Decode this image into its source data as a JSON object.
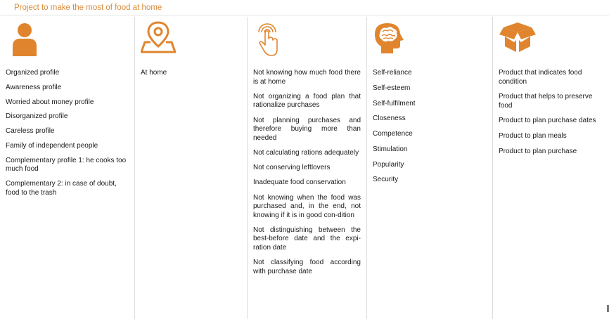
{
  "title": "Project to make the most of food at home",
  "accent_color": "#e0852e",
  "columns": [
    {
      "icon": "person-icon",
      "items": [
        "Organized profile",
        "Awareness profile",
        "Worried about money profile",
        "Disorganized profile",
        "Careless profile",
        "Family of independent people",
        "Complementary profile 1: he cooks too much food",
        "Complementary 2: in case of doubt, food to the trash"
      ]
    },
    {
      "icon": "location-map-icon",
      "items": [
        "At home"
      ]
    },
    {
      "icon": "touch-finger-icon",
      "items": [
        "Not knowing how much food there is at home",
        "Not organizing a food plan that rationalize purchases",
        "Not planning purchases and therefore buying more than needed",
        "Not calculating rations adequately",
        "Not conserving leftlovers",
        "Inadequate food conservation",
        "Not knowing when the food was purchased and, in the end, not knowing if it is in good con-dition",
        "Not distinguishing between the best-before date and the expi-ration date",
        "Not classifying food according with purchase date"
      ]
    },
    {
      "icon": "head-brain-icon",
      "items": [
        "Self-reliance",
        "Self-esteem",
        "Self-fulfilment",
        "Closeness",
        "Competence",
        "Stimulation",
        "Popularity",
        "Security"
      ]
    },
    {
      "icon": "open-box-icon",
      "items": [
        "Product that indicates food condition",
        "Product that helps to preserve food",
        "Product to plan purchase dates",
        "Product to plan meals",
        "Product to plan purchase"
      ]
    }
  ]
}
